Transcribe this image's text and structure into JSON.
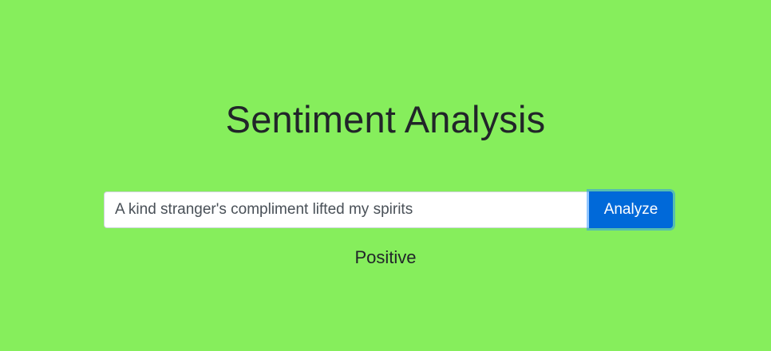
{
  "page": {
    "title": "Sentiment Analysis"
  },
  "form": {
    "input_value": "A kind stranger's compliment lifted my spirits",
    "button_label": "Analyze"
  },
  "result": {
    "label": "Positive"
  },
  "colors": {
    "background": "#86ee5c",
    "button": "#0069d9",
    "text": "#212529"
  }
}
